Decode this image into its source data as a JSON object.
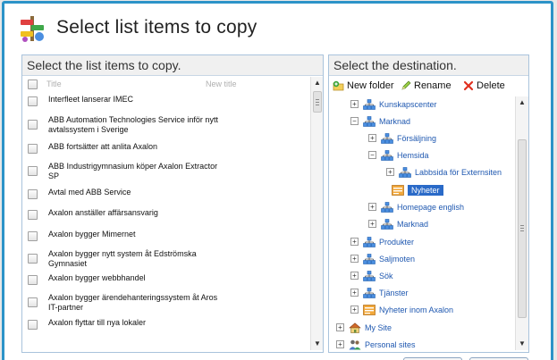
{
  "dialog": {
    "title": "Select list items to copy"
  },
  "left_panel": {
    "heading": "Select the list items to copy.",
    "columns": {
      "title": "Title",
      "new_title": "New title"
    },
    "items": [
      "Interfleet lanserar IMEC",
      "ABB Automation Technologies Service inför nytt avtalssystem i Sverige",
      "ABB fortsätter att anlita Axalon",
      "ABB Industrigymnasium köper Axalon Extractor SP",
      "Avtal med ABB Service",
      "Axalon anställer affärsansvarig",
      "Axalon bygger Mimernet",
      "Axalon bygger nytt system åt Edströmska Gymnasiet",
      "Axalon bygger webbhandel",
      "Axalon bygger ärendehanteringssystem åt Aros IT-partner",
      "Axalon flyttar till nya lokaler"
    ]
  },
  "right_panel": {
    "heading": "Select the destination.",
    "toolbar": {
      "new_folder": "New folder",
      "rename": "Rename",
      "delete": "Delete"
    },
    "tree": [
      {
        "label": "Kunskapscenter",
        "expander": "⊞",
        "icon": "site-icon"
      },
      {
        "label": "Marknad",
        "expander": "⊟",
        "icon": "site-icon"
      },
      {
        "label": "Försäljning",
        "expander": "⊞",
        "icon": "site-icon"
      },
      {
        "label": "Hemsida",
        "expander": "⊟",
        "icon": "site-icon"
      },
      {
        "label": "Labbsida för Externsiten",
        "expander": "⊞",
        "icon": "site-icon"
      },
      {
        "label": "Nyheter",
        "expander": "",
        "icon": "list-icon"
      },
      {
        "label": "Homepage english",
        "expander": "⊞",
        "icon": "site-icon"
      },
      {
        "label": "Marknad",
        "expander": "⊞",
        "icon": "site-icon"
      },
      {
        "label": "Produkter",
        "expander": "⊞",
        "icon": "site-icon"
      },
      {
        "label": "Saljmoten",
        "expander": "⊞",
        "icon": "site-icon"
      },
      {
        "label": "Sök",
        "expander": "⊞",
        "icon": "site-icon"
      },
      {
        "label": "Tjänster",
        "expander": "⊞",
        "icon": "site-icon"
      },
      {
        "label": "Nyheter inom Axalon",
        "expander": "⊞",
        "icon": "list-icon"
      },
      {
        "label": "My Site",
        "expander": "⊞",
        "icon": "house-icon"
      },
      {
        "label": "Personal sites",
        "expander": "⊞",
        "icon": "people-icon"
      }
    ],
    "selected_node": "Nyheter"
  },
  "colors": {
    "accent": "#2c93c8",
    "panel_border": "#a9c3dc",
    "link": "#1f58b0",
    "selection": "#2a6ac8"
  }
}
